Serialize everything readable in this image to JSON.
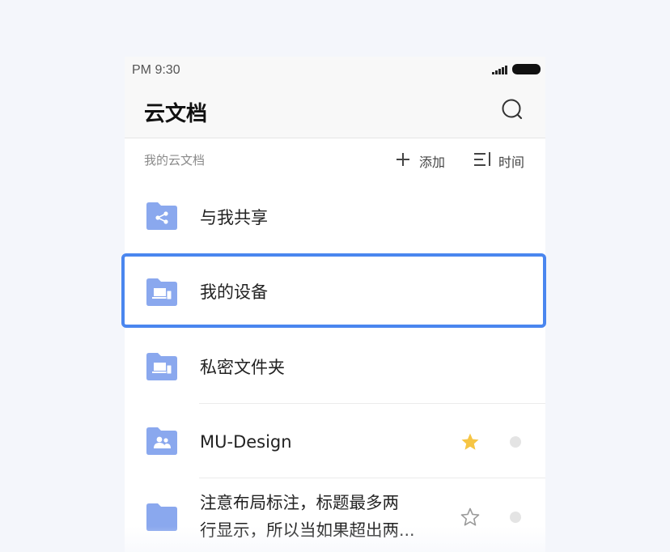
{
  "status_bar": {
    "time": "PM 9:30"
  },
  "app_bar": {
    "title": "云文档",
    "search_icon": "search-icon"
  },
  "sub_header": {
    "section_title": "我的云文档",
    "add_label": "添加",
    "sort_label": "时间"
  },
  "items": [
    {
      "label": "与我共享",
      "icon": "folder-share-icon"
    },
    {
      "label": "我的设备",
      "icon": "folder-device-icon",
      "selected": true
    },
    {
      "label": "私密文件夹",
      "icon": "folder-device-icon"
    },
    {
      "label": "MU-Design",
      "icon": "folder-group-icon",
      "starred": true
    },
    {
      "label": "注意布局标注，标题最多两行显示，所以当如果超出两...",
      "line1": "注意布局标注，标题最多两",
      "line2": "行显示，所以当如果超出两...",
      "icon": "folder-icon",
      "starred": false
    }
  ],
  "colors": {
    "accent": "#4a86ef",
    "folder": "#8aa8ee",
    "star": "#f6c544"
  }
}
